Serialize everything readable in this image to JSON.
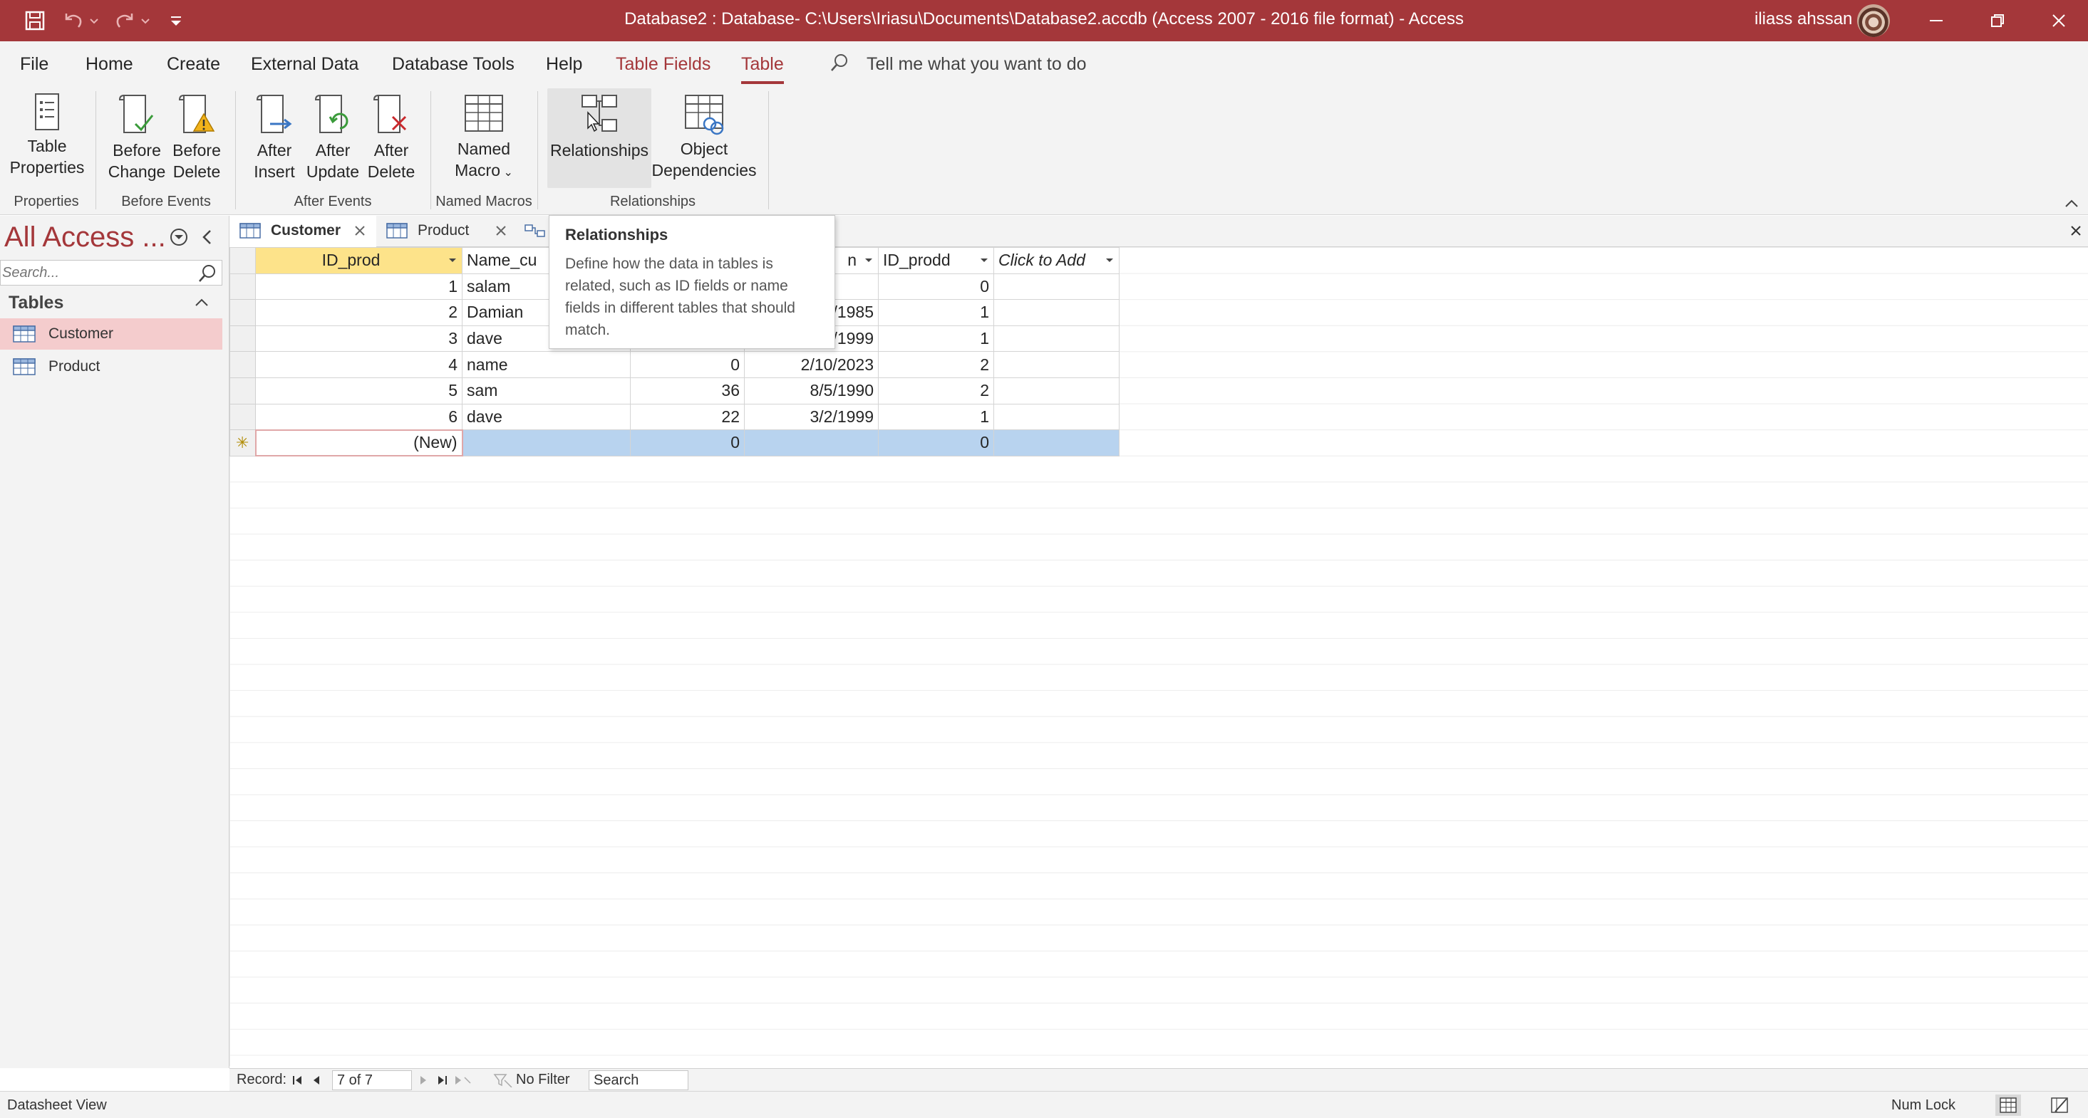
{
  "titlebar": {
    "title": "Database2 : Database- C:\\Users\\Iriasu\\Documents\\Database2.accdb (Access 2007 - 2016 file format)  -  Access",
    "user_name": "iliass ahssan",
    "icons": [
      "save-icon",
      "undo-icon",
      "redo-icon",
      "customize-qat-icon",
      "minimize-icon",
      "restore-icon",
      "close-icon"
    ]
  },
  "menu": {
    "tabs": [
      "File",
      "Home",
      "Create",
      "External Data",
      "Database Tools",
      "Help",
      "Table Fields",
      "Table"
    ],
    "active": "Table",
    "tell_me": "Tell me what you want to do"
  },
  "ribbon": {
    "table_properties": [
      "Table",
      "Properties"
    ],
    "before_change": [
      "Before",
      "Change"
    ],
    "before_delete": [
      "Before",
      "Delete"
    ],
    "after_insert": [
      "After",
      "Insert"
    ],
    "after_update": [
      "After",
      "Update"
    ],
    "after_delete": [
      "After",
      "Delete"
    ],
    "named_macro": [
      "Named",
      "Macro"
    ],
    "relationships": "Relationships",
    "object_dependencies": [
      "Object",
      "Dependencies"
    ],
    "groups": [
      "Properties",
      "Before Events",
      "After Events",
      "Named Macros",
      "Relationships"
    ]
  },
  "nav": {
    "title": "All Access ...",
    "search_placeholder": "Search...",
    "section": "Tables",
    "items": [
      "Customer",
      "Product"
    ],
    "selected": "Customer"
  },
  "doc_tabs": [
    {
      "label": "Customer",
      "active": true
    },
    {
      "label": "Product",
      "active": false
    }
  ],
  "grid": {
    "columns": [
      "ID_prod",
      "Name_cu",
      "",
      "n",
      "ID_prodd",
      "Click to Add"
    ],
    "rows": [
      [
        "1",
        "salam",
        "",
        "",
        "0"
      ],
      [
        "2",
        "Damian",
        "",
        "/1985",
        "1"
      ],
      [
        "3",
        "dave",
        "",
        "/1999",
        "1"
      ],
      [
        "4",
        "name",
        "0",
        "2/10/2023",
        "2"
      ],
      [
        "5",
        "sam",
        "36",
        "8/5/1990",
        "2"
      ],
      [
        "6",
        "dave",
        "22",
        "3/2/1999",
        "1"
      ]
    ],
    "new_row": [
      "(New)",
      "",
      "0",
      "",
      "0"
    ],
    "new_row_marker": "✳"
  },
  "tooltip": {
    "title": "Relationships",
    "body": "Define how the data in tables is related, such as ID fields or name fields in different tables that should match."
  },
  "record_nav": {
    "label": "Record:",
    "position": "7 of 7",
    "filter": "No Filter",
    "search": "Search"
  },
  "status": {
    "left": "Datasheet View",
    "num_lock": "Num Lock"
  },
  "colors": {
    "accent": "#a4373a",
    "selected_header": "#fde38a",
    "new_row": "#b8d3ef",
    "nav_selected": "#f4cccd"
  }
}
